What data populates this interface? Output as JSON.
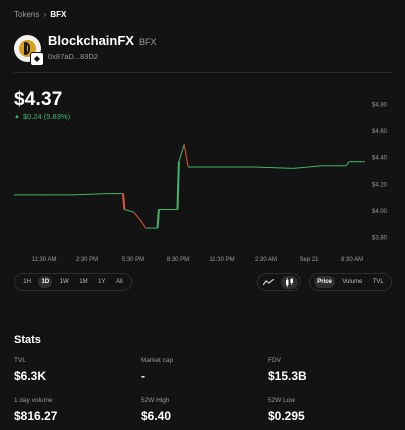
{
  "breadcrumb": {
    "parent": "Tokens",
    "current": "BFX"
  },
  "token": {
    "name": "BlockchainFX",
    "symbol": "BFX",
    "address": "0x87aD...83D2"
  },
  "price": {
    "value": "$4.37",
    "change": "$0.24 (5.83%)",
    "direction": "up",
    "up_color": "#40b66b",
    "down_color": "#e5533a"
  },
  "chart_data": {
    "type": "line",
    "y_ticks": [
      "$4.80",
      "$4.60",
      "$4.40",
      "$4.20",
      "$4.00",
      "$3.80"
    ],
    "x_ticks": [
      "11:30 AM",
      "2:30 PM",
      "5:30 PM",
      "8:30 PM",
      "11:30 PM",
      "2:30 AM",
      "Sep 21",
      "8:30 AM"
    ],
    "ylim": [
      3.75,
      4.85
    ],
    "points": [
      [
        0.0,
        4.12
      ],
      [
        1.2,
        4.12
      ],
      [
        2.2,
        4.12
      ],
      [
        3.5,
        4.13
      ],
      [
        4.1,
        4.13
      ],
      [
        4.15,
        4.01
      ],
      [
        4.5,
        3.99
      ],
      [
        4.75,
        3.93
      ],
      [
        4.95,
        3.87
      ],
      [
        5.4,
        3.87
      ],
      [
        5.45,
        4.01
      ],
      [
        6.15,
        4.01
      ],
      [
        6.2,
        4.37
      ],
      [
        6.4,
        4.5
      ],
      [
        6.55,
        4.33
      ],
      [
        7.5,
        4.33
      ],
      [
        9.0,
        4.33
      ],
      [
        10.5,
        4.32
      ],
      [
        11.6,
        4.34
      ],
      [
        12.5,
        4.34
      ],
      [
        12.6,
        4.37
      ],
      [
        13.2,
        4.37
      ]
    ],
    "grid": false
  },
  "ranges": [
    "1H",
    "1D",
    "1W",
    "1M",
    "1Y",
    "All"
  ],
  "active_range": "1D",
  "metrics": [
    "Price",
    "Volume",
    "TVL"
  ],
  "active_metric": "Price",
  "stats": {
    "title": "Stats",
    "items": [
      {
        "label": "TVL",
        "value": "$6.3K"
      },
      {
        "label": "Market cap",
        "value": "-"
      },
      {
        "label": "FDV",
        "value": "$15.3B"
      },
      {
        "label": "1 day volume",
        "value": "$816.27"
      },
      {
        "label": "52W High",
        "value": "$6.40"
      },
      {
        "label": "52W Low",
        "value": "$0.295"
      }
    ]
  }
}
